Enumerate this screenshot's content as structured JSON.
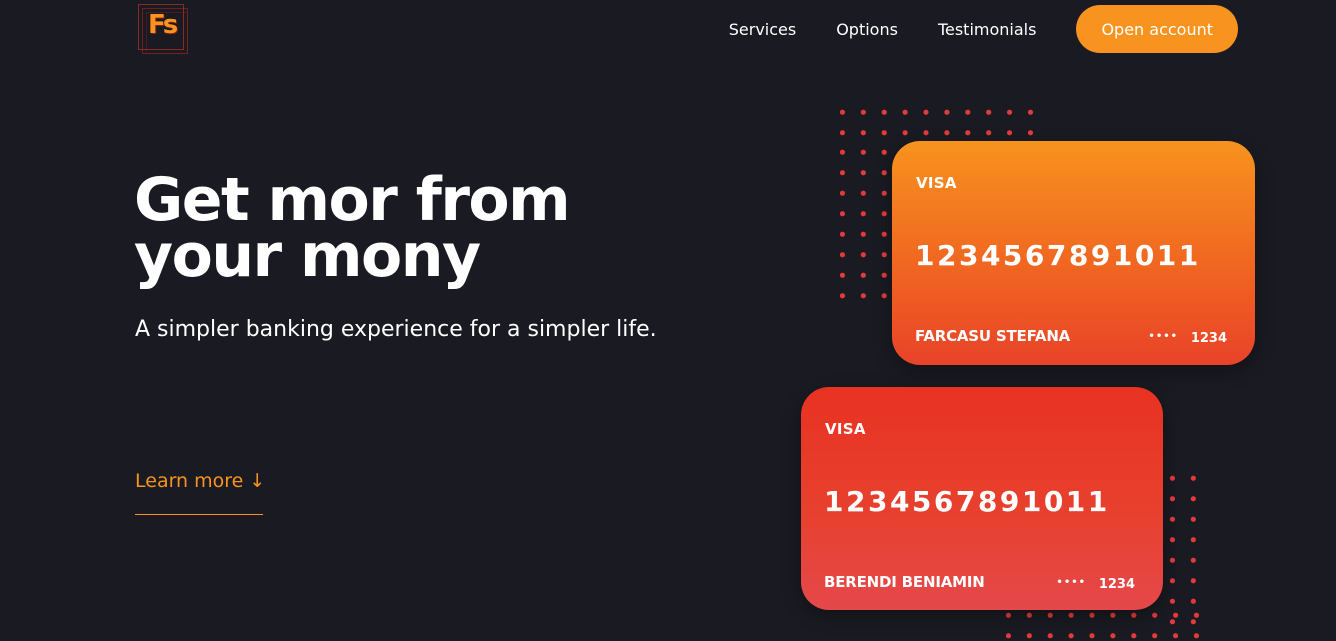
{
  "logo": {
    "text": "Fs"
  },
  "nav": {
    "links": [
      "Services",
      "Options",
      "Testimonials"
    ],
    "cta": "Open account"
  },
  "hero": {
    "title_line1": "Get mor from",
    "title_line2": "your mony",
    "subtitle": "A simpler banking experience for a simpler life.",
    "learn_more": "Learn more ↓"
  },
  "cards": [
    {
      "brand": "VISA",
      "number": "1234567891011",
      "holder": "FARCASU STEFANA",
      "mask": "••••",
      "last4": "1234"
    },
    {
      "brand": "VISA",
      "number": "1234567891011",
      "holder": "BERENDI BENIAMIN",
      "mask": "••••",
      "last4": "1234"
    }
  ],
  "colors": {
    "background": "#1a1a22",
    "accent": "#f7931e",
    "card_orange_top": "#f7931e",
    "card_orange_bottom": "#e8432a",
    "card_red": "#e8402e",
    "dots": "#e63a3a",
    "text": "#ffffff"
  }
}
